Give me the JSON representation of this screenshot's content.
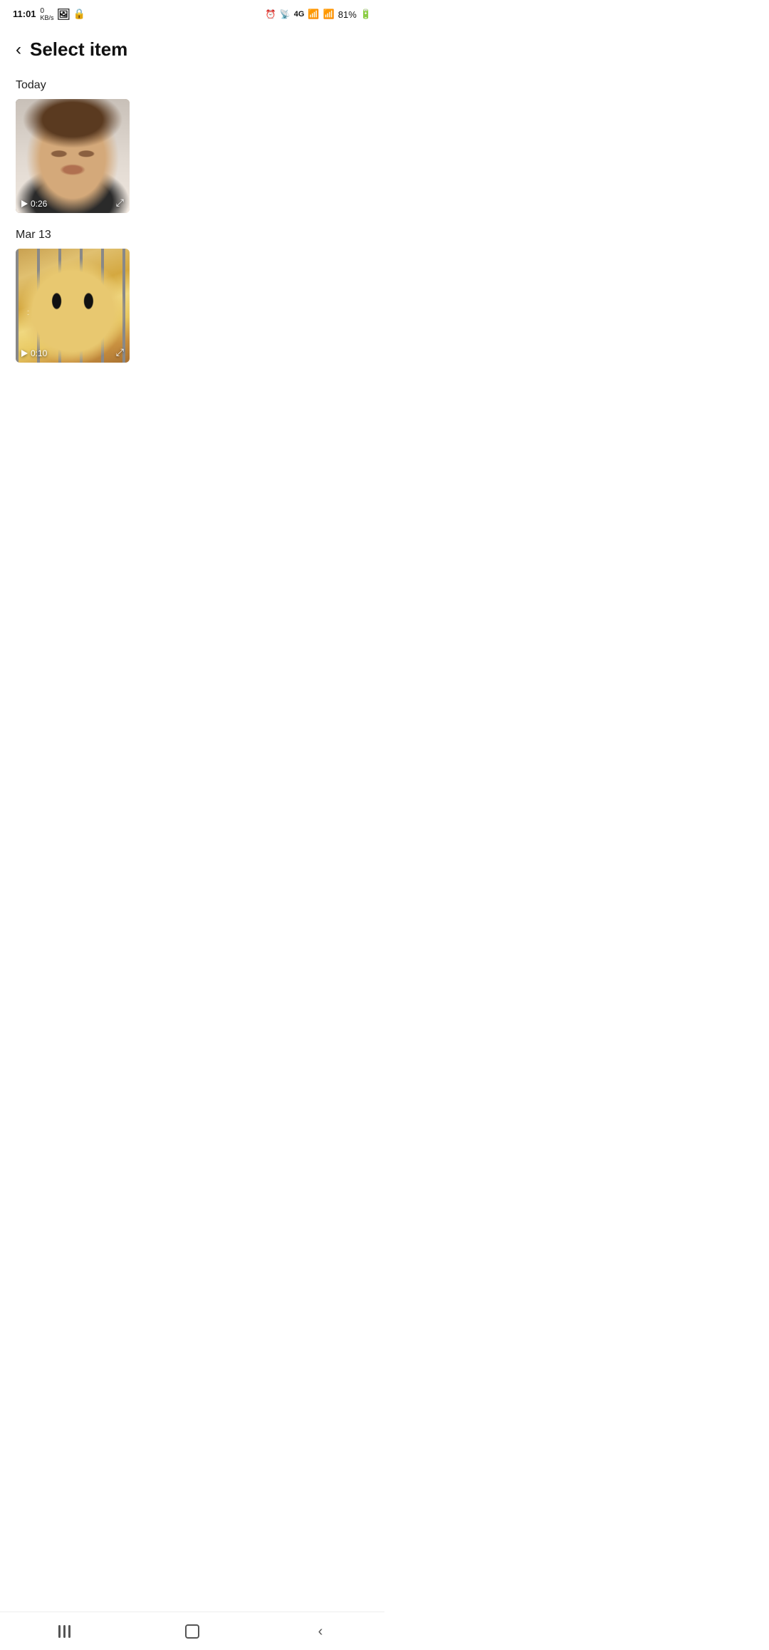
{
  "statusBar": {
    "time": "11:01",
    "dataSpeed": "0 KB/s",
    "battery": "81%"
  },
  "header": {
    "backLabel": "‹",
    "title": "Select item"
  },
  "sections": [
    {
      "label": "Today",
      "items": [
        {
          "id": "video-rick",
          "duration": "0:26",
          "type": "video",
          "cssClass": "rick"
        }
      ]
    },
    {
      "label": "Mar 13",
      "items": [
        {
          "id": "video-cat",
          "duration": "0:10",
          "type": "video",
          "cssClass": "cat"
        }
      ]
    }
  ],
  "navBar": {
    "recentLabel": "Recent",
    "homeLabel": "Home",
    "backLabel": "Back"
  }
}
